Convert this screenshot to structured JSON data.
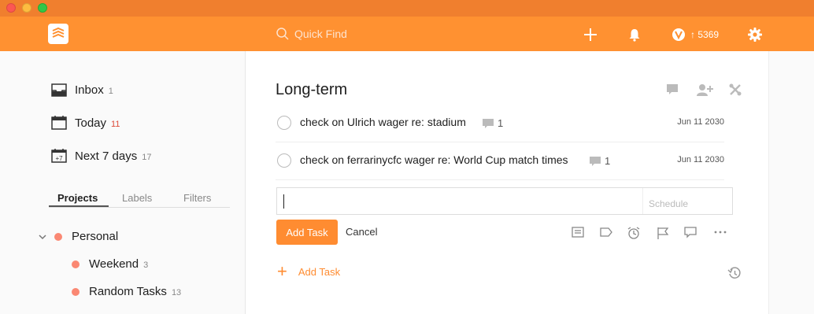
{
  "colors": {
    "brand": "#ff9131",
    "project_dot": "#fa8873",
    "accent_button": "#ff8c31"
  },
  "header": {
    "search_placeholder": "Quick Find",
    "karma_value": "5369",
    "karma_arrow": "↑"
  },
  "sidebar": {
    "nav": [
      {
        "label": "Inbox",
        "count": "1",
        "icon": "inbox-icon"
      },
      {
        "label": "Today",
        "count": "11",
        "icon": "calendar-today-icon"
      },
      {
        "label": "Next 7 days",
        "count": "17",
        "icon": "calendar-week-icon"
      }
    ],
    "tabs": [
      {
        "label": "Projects",
        "active": true
      },
      {
        "label": "Labels",
        "active": false
      },
      {
        "label": "Filters",
        "active": false
      }
    ],
    "projects": [
      {
        "label": "Personal",
        "count": "",
        "expanded": true
      },
      {
        "label": "Weekend",
        "count": "3"
      },
      {
        "label": "Random Tasks",
        "count": "13"
      }
    ]
  },
  "main": {
    "title": "Long-term",
    "tasks": [
      {
        "text": "check on Ulrich wager re: stadium",
        "comments": "1",
        "date": "Jun 11 2030"
      },
      {
        "text": "check on ferrarinycfc wager re: World Cup match times",
        "comments": "1",
        "date": "Jun 11 2030"
      }
    ],
    "editor": {
      "value": "",
      "schedule_placeholder": "Schedule"
    },
    "add_button": "Add Task",
    "cancel_button": "Cancel",
    "add_task_link": "Add Task"
  }
}
